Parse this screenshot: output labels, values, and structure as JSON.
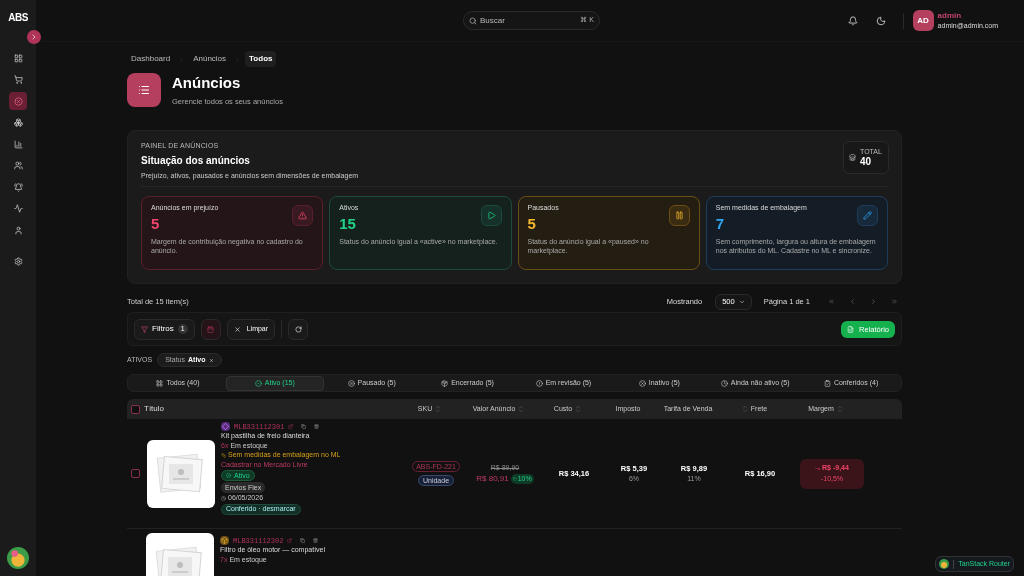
{
  "sidebar": {
    "logo": "ABS",
    "items": [
      {
        "selected": false
      },
      {
        "selected": false
      },
      {
        "selected": true
      },
      {
        "selected": false
      },
      {
        "selected": false
      },
      {
        "selected": false
      },
      {
        "selected": false
      },
      {
        "selected": false
      },
      {
        "selected": false
      },
      {
        "selected": false
      }
    ]
  },
  "header": {
    "search": {
      "placeholder": "Buscar",
      "shortcut": "⌘ K"
    },
    "user": {
      "initials": "AD",
      "name": "admin",
      "email": "admin@admin.com"
    }
  },
  "breadcrumb": [
    {
      "label": "Dashboard",
      "selected": false
    },
    {
      "label": "Anúncios",
      "selected": false
    },
    {
      "label": "Todos",
      "selected": true
    }
  ],
  "page": {
    "title": "Anúncios",
    "subtitle": "Gerencie todos os seus anúncios"
  },
  "panel": {
    "eyebrow": "PAINEL DE ANÚNCIOS",
    "title": "Situação dos anúncios",
    "subtitle": "Prejuízo, ativos, pausados e anúncios sem dimensões de embalagem",
    "total_label": "TOTAL",
    "total": "40",
    "cards": [
      {
        "kind": "loss",
        "label": "Anúncios em prejuízo",
        "value": "5",
        "description": "Margem de contribuição negativa no cadastro do anúncio."
      },
      {
        "kind": "active",
        "label": "Ativos",
        "value": "15",
        "description": "Status do anúncio igual a «active» no marketplace."
      },
      {
        "kind": "paused",
        "label": "Pausados",
        "value": "5",
        "description": "Status do anúncio igual a «paused» no marketplace."
      },
      {
        "kind": "dimensions",
        "label": "Sem medidas de embalagem",
        "value": "7",
        "description": "Sem comprimento, largura ou altura de embalagem nos atributos do ML. Cadastre no ML e sincronize."
      }
    ]
  },
  "summary": {
    "total": "Total de 15 item(s)",
    "showing_label": "Mostrando",
    "page_size": "500",
    "page_info": "Página 1 de 1"
  },
  "toolbar": {
    "filters": "Filtros",
    "filter_count": "1",
    "clear": "Limpar",
    "report": "Relatório"
  },
  "active_filters": {
    "label": "ATIVOS",
    "chips": [
      {
        "key": "Status",
        "value": "Ativo"
      }
    ]
  },
  "tabs": [
    {
      "label": "Todos (40)",
      "selected": false
    },
    {
      "label": "Ativo (15)",
      "selected": true
    },
    {
      "label": "Pausado (5)",
      "selected": false
    },
    {
      "label": "Encerrado (5)",
      "selected": false
    },
    {
      "label": "Em revisão (5)",
      "selected": false
    },
    {
      "label": "Inativo (5)",
      "selected": false
    },
    {
      "label": "Ainda não ativo (5)",
      "selected": false
    },
    {
      "label": "Conferidos (4)",
      "selected": false
    }
  ],
  "table": {
    "select_all_checked": false,
    "columns": [
      "Título",
      "SKU",
      "Valor Anúncio",
      "Custo",
      "Imposto",
      "Tarifa de Venda",
      "Frete",
      "Margem"
    ],
    "rows": [
      {
        "kind": "ml",
        "checked": false,
        "id": "MLB331112301",
        "title": "Kit pastilha de freio dianteira",
        "stock_count": "6x",
        "stock": "Em estoque",
        "warning": "Sem medidas de embalagem no ML",
        "link": "Cadastrar no Mercado Livre",
        "status": "Ativo",
        "shipping": "Envios Flex",
        "date": "06/05/2026",
        "checked_tag": "Conferido · desmarcar",
        "sku": "ABS-FD-221",
        "unit": "Unidade",
        "old_price": "R$ 89,90",
        "price": "R$ 80,91",
        "discount": "10%",
        "cost": "R$ 34,16",
        "tax": "R$ 5,39",
        "tax_pct": "6%",
        "fee": "R$ 9,89",
        "fee_pct": "11%",
        "shipping_cost": "R$ 16,90",
        "margin": {
          "kind": "loss",
          "value": "R$ -9,44",
          "percent": "-10,5%"
        }
      },
      {
        "kind": "shop",
        "id": "MLB331112302",
        "title": "Filtro de óleo motor — compatível",
        "stock_count": "7x",
        "stock": "Em estoque"
      }
    ]
  },
  "devtools": {
    "label": "TanStack Router"
  }
}
